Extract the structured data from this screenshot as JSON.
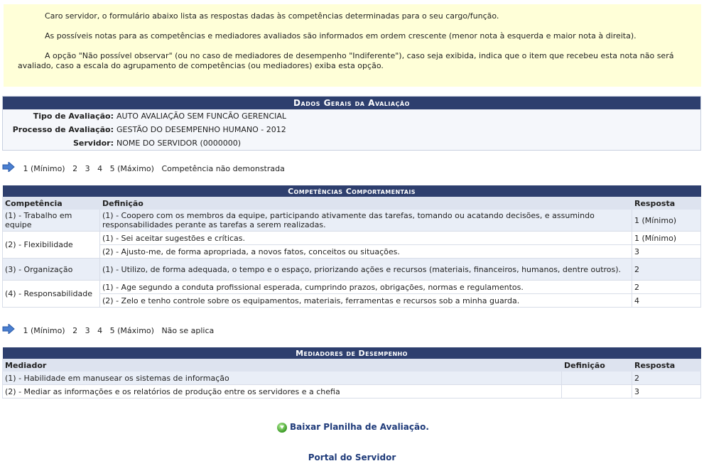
{
  "notice": {
    "p1": "Caro servidor, o formulário abaixo lista as respostas dadas às competências determinadas para o seu cargo/função.",
    "p2": "As possíveis notas para as competências e mediadores avaliados são informados em ordem crescente (menor nota à esquerda e maior nota à direita).",
    "p3": "A opção \"Não possível observar\" (ou no caso de mediadores de desempenho \"Indiferente\"), caso seja exibida, indica que o item que recebeu esta nota não será avaliado, caso a escala do agrupamento de competências (ou mediadores) exiba esta opção."
  },
  "general": {
    "title": "Dados Gerais da Avaliação",
    "rows": [
      {
        "label": "Tipo de Avaliação:",
        "value": "AUTO AVALIAÇÃO SEM FUNCÃO GERENCIAL"
      },
      {
        "label": "Processo de Avaliação:",
        "value": "GESTÃO DO DESEMPENHO HUMANO - 2012"
      },
      {
        "label": "Servidor:",
        "value": "NOME DO SERVIDOR (0000000)"
      }
    ]
  },
  "scale1": [
    "1 (Mínimo)",
    "2",
    "3",
    "4",
    "5 (Máximo)",
    "Competência não demonstrada"
  ],
  "competencies": {
    "title": "Competências Comportamentais",
    "headers": [
      "Competência",
      "Definição",
      "Resposta"
    ],
    "rows": [
      {
        "comp": "(1) - Trabalho em equipe",
        "def": "(1) - Coopero com os membros da equipe, participando ativamente das tarefas, tomando ou acatando decisões, e assumindo responsabilidades perante as tarefas a serem realizadas.",
        "resp": "1 (Mínimo)"
      },
      {
        "comp": "(2) - Flexibilidade",
        "def": "(1) - Sei aceitar sugestões e críticas.",
        "resp": "1 (Mínimo)"
      },
      {
        "comp": "",
        "def": "(2) - Ajusto-me, de forma apropriada, a novos fatos, conceitos ou situações.",
        "resp": "3"
      },
      {
        "comp": "(3) - Organização",
        "def": "(1) - Utilizo, de forma adequada, o tempo e o espaço, priorizando ações e recursos (materiais, financeiros, humanos, dentre outros).",
        "resp": "2"
      },
      {
        "comp": "(4) - Responsabilidade",
        "def": "(1) - Age segundo a conduta profissional esperada, cumprindo prazos, obrigações, normas e regulamentos.",
        "resp": "2"
      },
      {
        "comp": "",
        "def": "(2) - Zelo e tenho controle sobre os equipamentos, materiais, ferramentas e recursos sob a minha guarda.",
        "resp": "4"
      }
    ]
  },
  "scale2": [
    "1 (Mínimo)",
    "2",
    "3",
    "4",
    "5 (Máximo)",
    "Não se aplica"
  ],
  "mediators": {
    "title": "Mediadores de Desempenho",
    "headers": [
      "Mediador",
      "Definição",
      "Resposta"
    ],
    "rows": [
      {
        "med": "(1) - Habilidade em manusear os sistemas de informação",
        "def": "",
        "resp": "2"
      },
      {
        "med": "(2) - Mediar as informações e os relatórios de produção entre os servidores e a chefia",
        "def": "",
        "resp": "3"
      }
    ]
  },
  "download_label": "Baixar Planilha de Avaliação.",
  "portal_label": "Portal do Servidor"
}
